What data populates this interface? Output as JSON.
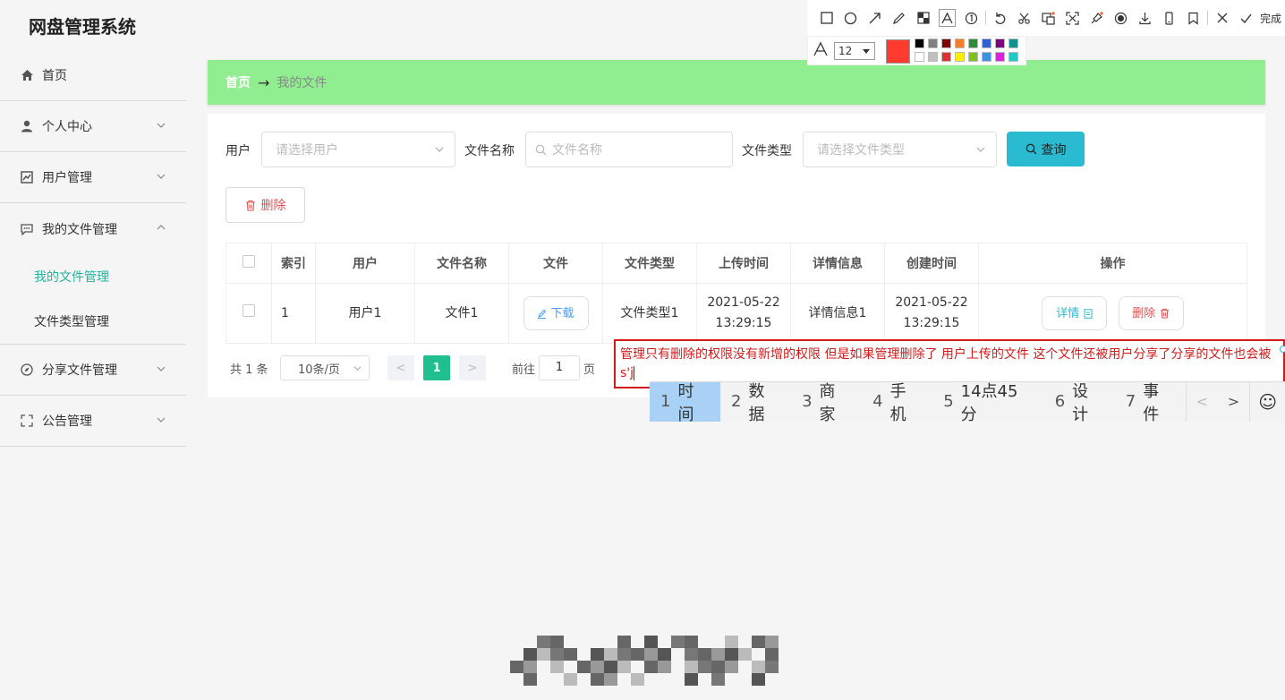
{
  "app": {
    "title": "网盘管理系统"
  },
  "sidebar": {
    "items": [
      {
        "label": "首页",
        "icon": "home-icon"
      },
      {
        "label": "个人中心",
        "icon": "user-icon"
      },
      {
        "label": "用户管理",
        "icon": "chart-icon"
      },
      {
        "label": "我的文件管理",
        "icon": "message-icon"
      },
      {
        "label": "分享文件管理",
        "icon": "compass-icon"
      },
      {
        "label": "公告管理",
        "icon": "fullscreen-icon"
      }
    ],
    "sub_items": [
      {
        "label": "我的文件管理",
        "active": true
      },
      {
        "label": "文件类型管理",
        "active": false
      }
    ]
  },
  "breadcrumb": {
    "home": "首页",
    "separator": "→",
    "current": "我的文件"
  },
  "filters": {
    "user_label": "用户",
    "user_placeholder": "请选择用户",
    "filename_label": "文件名称",
    "filename_placeholder": "文件名称",
    "filetype_label": "文件类型",
    "filetype_placeholder": "请选择文件类型",
    "query_label": "查询"
  },
  "toolbar": {
    "delete_label": "删除"
  },
  "table": {
    "headers": [
      "索引",
      "用户",
      "文件名称",
      "文件",
      "文件类型",
      "上传时间",
      "详情信息",
      "创建时间",
      "操作"
    ],
    "rows": [
      {
        "index": "1",
        "user": "用户1",
        "filename": "文件1",
        "download_label": "下载",
        "filetype": "文件类型1",
        "upload_date": "2021-05-22",
        "upload_time": "13:29:15",
        "detail": "详情信息1",
        "created_date": "2021-05-22",
        "created_time": "13:29:15",
        "detail_btn": "详情",
        "delete_btn": "删除"
      }
    ]
  },
  "pagination": {
    "total": "共 1 条",
    "page_size": "10条/页",
    "prev": "<",
    "current": "1",
    "next": ">",
    "goto_label": "前往",
    "goto_value": "1",
    "page_label": "页"
  },
  "annotation_toolbar": {
    "done_label": "完成",
    "font_size": "12",
    "current_color": "#ff3b30",
    "palette": [
      "#000000",
      "#808080",
      "#800000",
      "#f08030",
      "#2e8b3a",
      "#3060d0",
      "#800080",
      "#109090",
      "#ffffff",
      "#c0c0c0",
      "#e03030",
      "#ffee00",
      "#80c020",
      "#4090e0",
      "#e020e0",
      "#20c8c8"
    ]
  },
  "annotation_text": "管理只有删除的权限没有新增的权限 但是如果管理删除了 用户上传的文件 这个文件还被用户分享了分享的文件也会被s'j",
  "ime": {
    "candidates": [
      {
        "n": "1",
        "text": "时间"
      },
      {
        "n": "2",
        "text": "数据"
      },
      {
        "n": "3",
        "text": "商家"
      },
      {
        "n": "4",
        "text": "手机"
      },
      {
        "n": "5",
        "text": "14点45分"
      },
      {
        "n": "6",
        "text": "设计"
      },
      {
        "n": "7",
        "text": "事件"
      }
    ],
    "prev": "<",
    "next": ">",
    "emoji": "☺"
  },
  "colors": {
    "accent": "#27b39a",
    "breadcrumb_bg": "#90ee90",
    "query_bg": "#2bbbd1",
    "page_active": "#1fbf8f",
    "danger": "#e05050"
  }
}
